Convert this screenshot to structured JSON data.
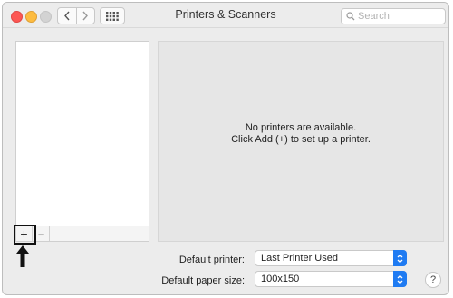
{
  "window": {
    "title": "Printers & Scanners"
  },
  "toolbar": {
    "search_placeholder": "Search",
    "back_icon": "chevron-left-icon",
    "forward_icon": "chevron-right-icon",
    "grid_icon": "grid-icon"
  },
  "printer_list": {
    "add_label": "+",
    "remove_label": "−"
  },
  "detail": {
    "empty_line1": "No printers are available.",
    "empty_line2": "Click Add (+) to set up a printer."
  },
  "settings": {
    "default_printer_label": "Default printer:",
    "default_printer_value": "Last Printer Used",
    "default_paper_label": "Default paper size:",
    "default_paper_value": "100x150"
  },
  "help": {
    "label": "?"
  },
  "colors": {
    "accent": "#1f7bf2",
    "close": "#fc5753",
    "minimize": "#fdbc40"
  }
}
